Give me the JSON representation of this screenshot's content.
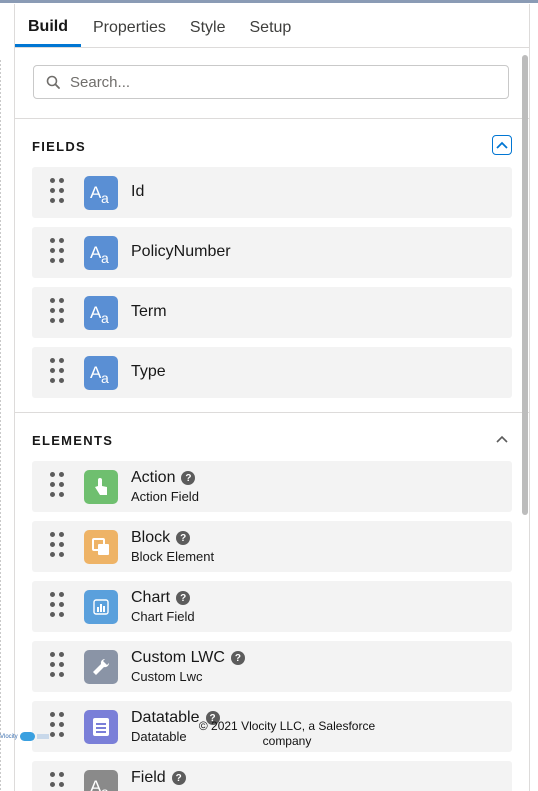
{
  "tabs": [
    {
      "label": "Build",
      "active": true
    },
    {
      "label": "Properties",
      "active": false
    },
    {
      "label": "Style",
      "active": false
    },
    {
      "label": "Setup",
      "active": false
    }
  ],
  "search": {
    "placeholder": "Search...",
    "icon": "search-icon"
  },
  "fields_section": {
    "title": "FIELDS",
    "items": [
      {
        "label": "Id",
        "icon": "text-field-icon"
      },
      {
        "label": "PolicyNumber",
        "icon": "text-field-icon"
      },
      {
        "label": "Term",
        "icon": "text-field-icon"
      },
      {
        "label": "Type",
        "icon": "text-field-icon"
      }
    ]
  },
  "elements_section": {
    "title": "ELEMENTS",
    "items": [
      {
        "label": "Action",
        "sub": "Action Field",
        "icon": "touch-icon",
        "color": "#6fbf6f"
      },
      {
        "label": "Block",
        "sub": "Block Element",
        "icon": "block-icon",
        "color": "#eeb366"
      },
      {
        "label": "Chart",
        "sub": "Chart Field",
        "icon": "chart-icon",
        "color": "#5aa0dc"
      },
      {
        "label": "Custom LWC",
        "sub": "Custom Lwc",
        "icon": "wrench-icon",
        "color": "#8a94a6"
      },
      {
        "label": "Datatable",
        "sub": "Datatable",
        "icon": "table-icon",
        "color": "#7a7fd8"
      },
      {
        "label": "Field",
        "sub": "",
        "icon": "text-field-icon",
        "color": "#8a8a8a"
      }
    ]
  },
  "footer": {
    "text_line1": "© 2021 Vlocity LLC, a Salesforce",
    "text_line2": "company",
    "logo_text": "Vlocity"
  },
  "colors": {
    "accent": "#0176d3",
    "field_icon": "#5a8fd4"
  }
}
